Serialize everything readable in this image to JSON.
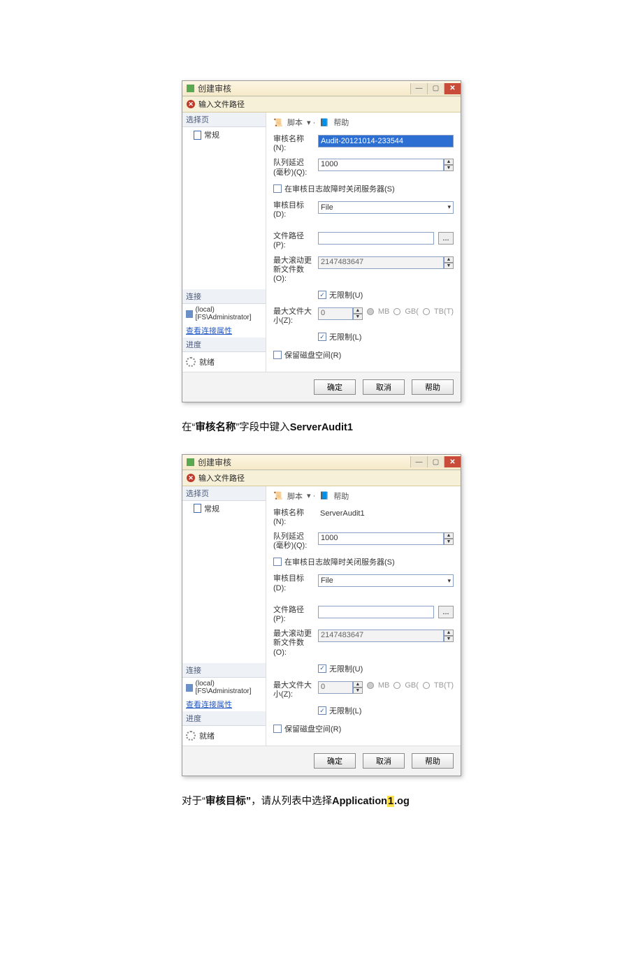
{
  "dialog": {
    "title": "创建审核",
    "error_bar": "输入文件路径",
    "sidebar": {
      "select_page_hdr": "选择页",
      "general_item": "常规",
      "connect_hdr": "连接",
      "connection": "(local) [FS\\Administrator]",
      "view_props_link": "查看连接属性",
      "progress_hdr": "进度",
      "ready_label": "就绪"
    },
    "toolbar": {
      "script": "脚本",
      "help": "帮助"
    },
    "labels": {
      "audit_name": "审核名称(N):",
      "queue_delay": "队列延迟(毫秒)(Q):",
      "shutdown_chk": "在审核日志故障时关闭服务器(S)",
      "audit_dest": "审核目标(D):",
      "file_path": "文件路径(P):",
      "max_rollover": "最大滚动更新文件数(O):",
      "unlimited_u": "无限制(U)",
      "max_size": "最大文件大小(Z):",
      "unlimited_l": "无限制(L)",
      "reserve_disk": "保留磁盘空间(R)",
      "size_mb": "MB",
      "size_gb": "GB(",
      "size_tb": "TB(T)"
    },
    "values_a": {
      "audit_name": "Audit-20121014-233544",
      "queue_delay": "1000",
      "audit_dest": "File",
      "file_path": "",
      "max_rollover": "2147483647",
      "max_size": "0"
    },
    "values_b": {
      "audit_name": "ServerAudit1",
      "queue_delay": "1000",
      "audit_dest": "File",
      "file_path": "",
      "max_rollover": "2147483647",
      "max_size": "0"
    },
    "buttons": {
      "ok": "确定",
      "cancel": "取消",
      "help": "帮助"
    }
  },
  "instructions": {
    "line1_pre": "在“",
    "line1_bold_field": "审核名称",
    "line1_mid": "”字段中键入",
    "line1_bold_value": "ServerAudit1",
    "line2_pre": "对于“",
    "line2_bold_field": "审核目标”",
    "line2_mid": "，请从列表中选择",
    "line2_bold_value_a": "Application",
    "line2_hl": "1",
    "line2_bold_value_b": ".og"
  }
}
